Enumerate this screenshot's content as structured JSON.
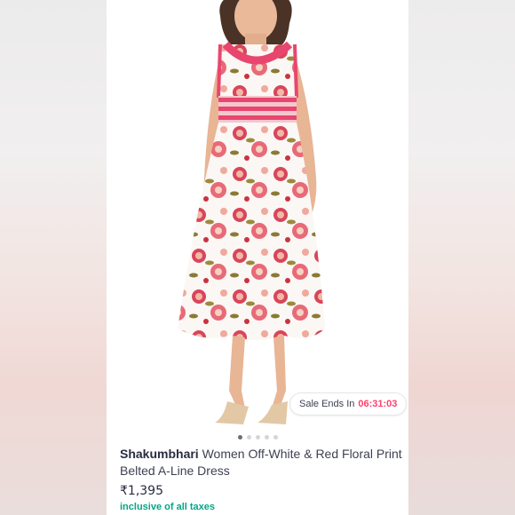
{
  "product": {
    "brand": "Shakumbhari",
    "name": "Women Off-White & Red Floral Print Belted A-Line Dress",
    "price": "₹1,395",
    "tax_note": "inclusive of all taxes",
    "image_description": "Model wearing an off-white sleeveless A-line midi dress with red and pink floral print, pink striped waist and embellished neckline, with beige heeled sandals"
  },
  "sale": {
    "label": "Sale Ends In",
    "countdown": "06:31:03"
  },
  "carousel": {
    "total_slides": 5,
    "active_index": 0
  },
  "colors": {
    "accent": "#ff3f6c",
    "tax_green": "#03a685",
    "dress_red": "#d9455a",
    "waist_pink": "#e8466e"
  }
}
